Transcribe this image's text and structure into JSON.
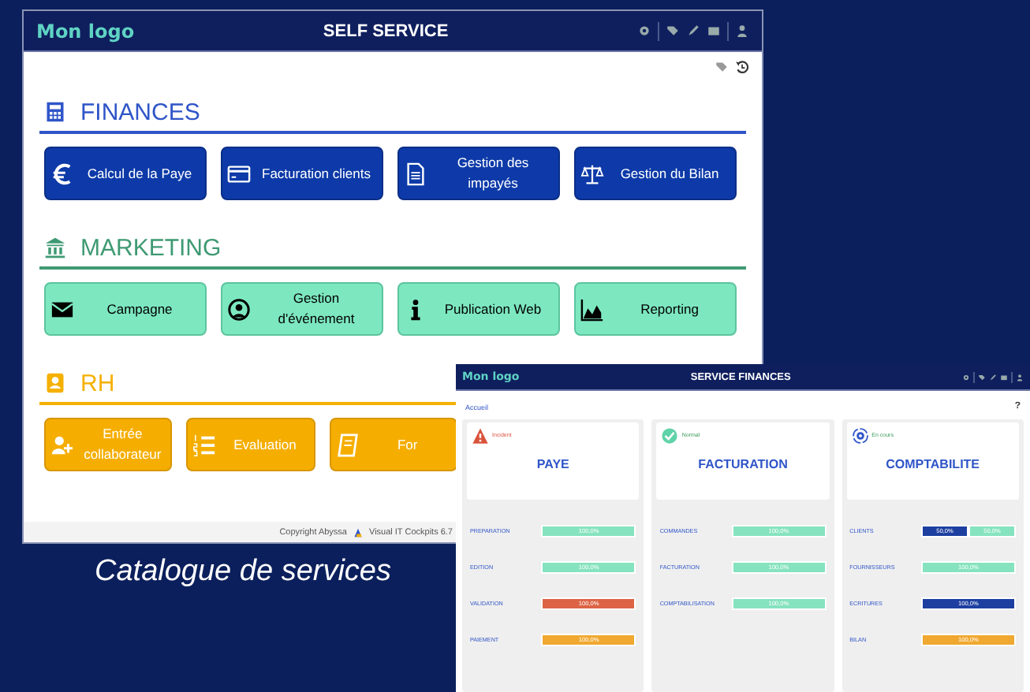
{
  "self_service_window": {
    "logo": "Mon logo",
    "title": "SELF SERVICE",
    "sections": [
      {
        "kind": "finances",
        "title": "FINANCES",
        "services": [
          {
            "label": "Calcul de la Paye",
            "kind": "euro"
          },
          {
            "label": "Facturation clients",
            "kind": "card"
          },
          {
            "label": "Gestion des impayés",
            "kind": "document"
          },
          {
            "label": "Gestion du Bilan",
            "kind": "scales"
          }
        ]
      },
      {
        "kind": "marketing",
        "title": "MARKETING",
        "services": [
          {
            "label": "Campagne",
            "kind": "envelope"
          },
          {
            "label": "Gestion d'événement",
            "kind": "person"
          },
          {
            "label": "Publication Web",
            "kind": "info"
          },
          {
            "label": "Reporting",
            "kind": "chart"
          }
        ]
      },
      {
        "kind": "rh",
        "title": "RH",
        "services": [
          {
            "label": "Entrée collaborateur",
            "kind": "user-add"
          },
          {
            "label": "Evaluation",
            "kind": "list"
          },
          {
            "label": "For",
            "kind": "book"
          }
        ]
      }
    ],
    "footer": {
      "copyright": "Copyright Abyssa",
      "version": "Visual IT Cockpits 6.7"
    }
  },
  "caption": "Catalogue de services",
  "finance_window": {
    "logo": "Mon logo",
    "title": "SERVICE FINANCES",
    "breadcrumb": "Accueil",
    "help": "?",
    "panels": [
      {
        "title": "PAYE",
        "status": {
          "kind": "incident",
          "label": "Incident"
        },
        "rows": [
          {
            "label": "PREPARATION",
            "segments": [
              {
                "text": "100,0%",
                "level": 1,
                "color": "#86e3bf"
              }
            ]
          },
          {
            "label": "EDITION",
            "segments": [
              {
                "text": "100,0%",
                "level": 1,
                "color": "#86e3bf"
              }
            ]
          },
          {
            "label": "VALIDATION",
            "segments": [
              {
                "text": "100,0%",
                "level": 1,
                "color": "#dc6444"
              }
            ]
          },
          {
            "label": "PAIEMENT",
            "segments": [
              {
                "text": "100,0%",
                "level": 1,
                "color": "#f0a830"
              }
            ]
          }
        ]
      },
      {
        "title": "FACTURATION",
        "status": {
          "kind": "ok",
          "label": "Normal"
        },
        "rows": [
          {
            "label": "COMMANDES",
            "segments": [
              {
                "text": "100,0%",
                "level": 1,
                "color": "#86e3bf"
              }
            ]
          },
          {
            "label": "FACTURATION",
            "segments": [
              {
                "text": "100,0%",
                "level": 1,
                "color": "#86e3bf"
              }
            ]
          },
          {
            "label": "COMPTABILISATION",
            "segments": [
              {
                "text": "100,0%",
                "level": 1,
                "color": "#86e3bf"
              }
            ]
          }
        ]
      },
      {
        "title": "COMPTABILITE",
        "status": {
          "kind": "progress",
          "label": "En cours"
        },
        "rows": [
          {
            "label": "CLIENTS",
            "segments": [
              {
                "text": "50,0%",
                "level": 0.5,
                "color": "#1d3fa0"
              },
              {
                "text": "50,0%",
                "level": 0.5,
                "color": "#86e3bf"
              }
            ]
          },
          {
            "label": "FOURNISSEURS",
            "segments": [
              {
                "text": "100,0%",
                "level": 1,
                "color": "#86e3bf"
              }
            ]
          },
          {
            "label": "ECRITURES",
            "segments": [
              {
                "text": "100,0%",
                "level": 1,
                "color": "#1d3fa0"
              }
            ]
          },
          {
            "label": "BILAN",
            "segments": [
              {
                "text": "100,0%",
                "level": 1,
                "color": "#f0a830"
              }
            ]
          }
        ]
      }
    ]
  }
}
